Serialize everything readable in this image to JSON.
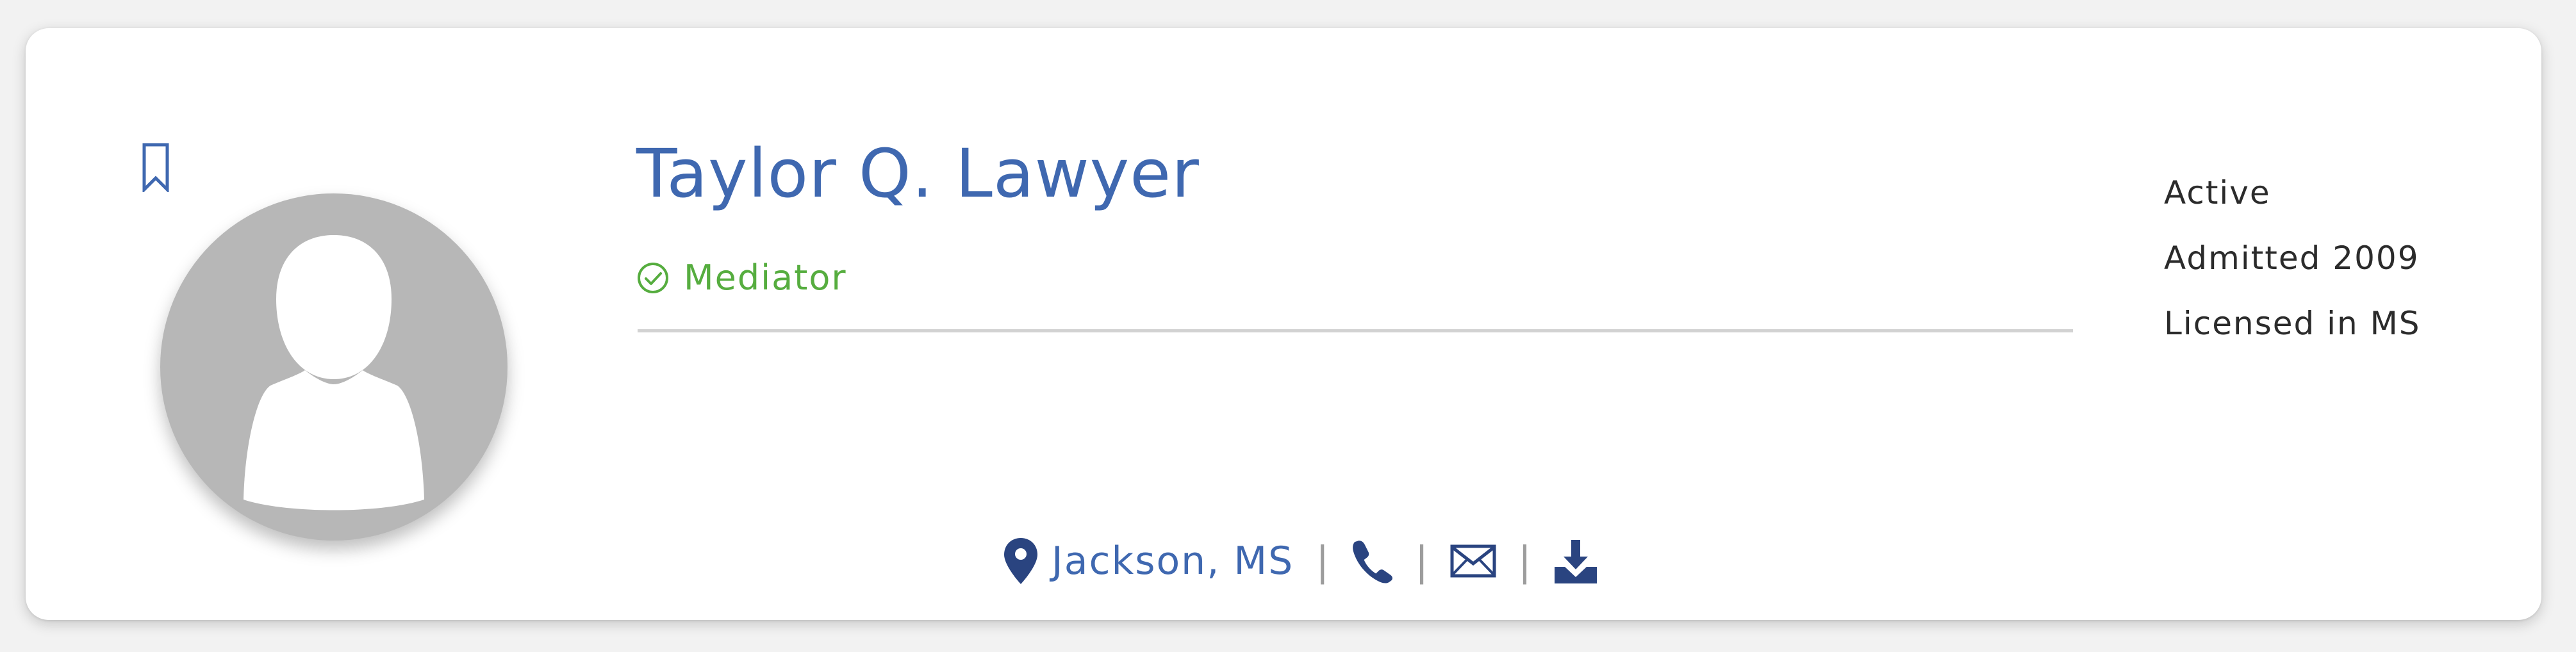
{
  "profile": {
    "name": "Taylor Q. Lawyer",
    "role": "Mediator",
    "status": [
      "Active",
      "Admitted 2009",
      "Licensed in MS"
    ],
    "location": "Jackson, MS",
    "separator": "|"
  },
  "icons": {
    "bookmark": "bookmark-icon",
    "avatar": "person-silhouette-icon",
    "role": "check-circle-icon",
    "location": "map-pin-icon",
    "phone": "phone-icon",
    "email": "envelope-icon",
    "download": "download-icon"
  },
  "colors": {
    "name": "#3f68b0",
    "icon_dark": "#2a4480",
    "role_green": "#56ad3f",
    "avatar_gray": "#b7b7b7",
    "divider": "#d2d2d2"
  }
}
